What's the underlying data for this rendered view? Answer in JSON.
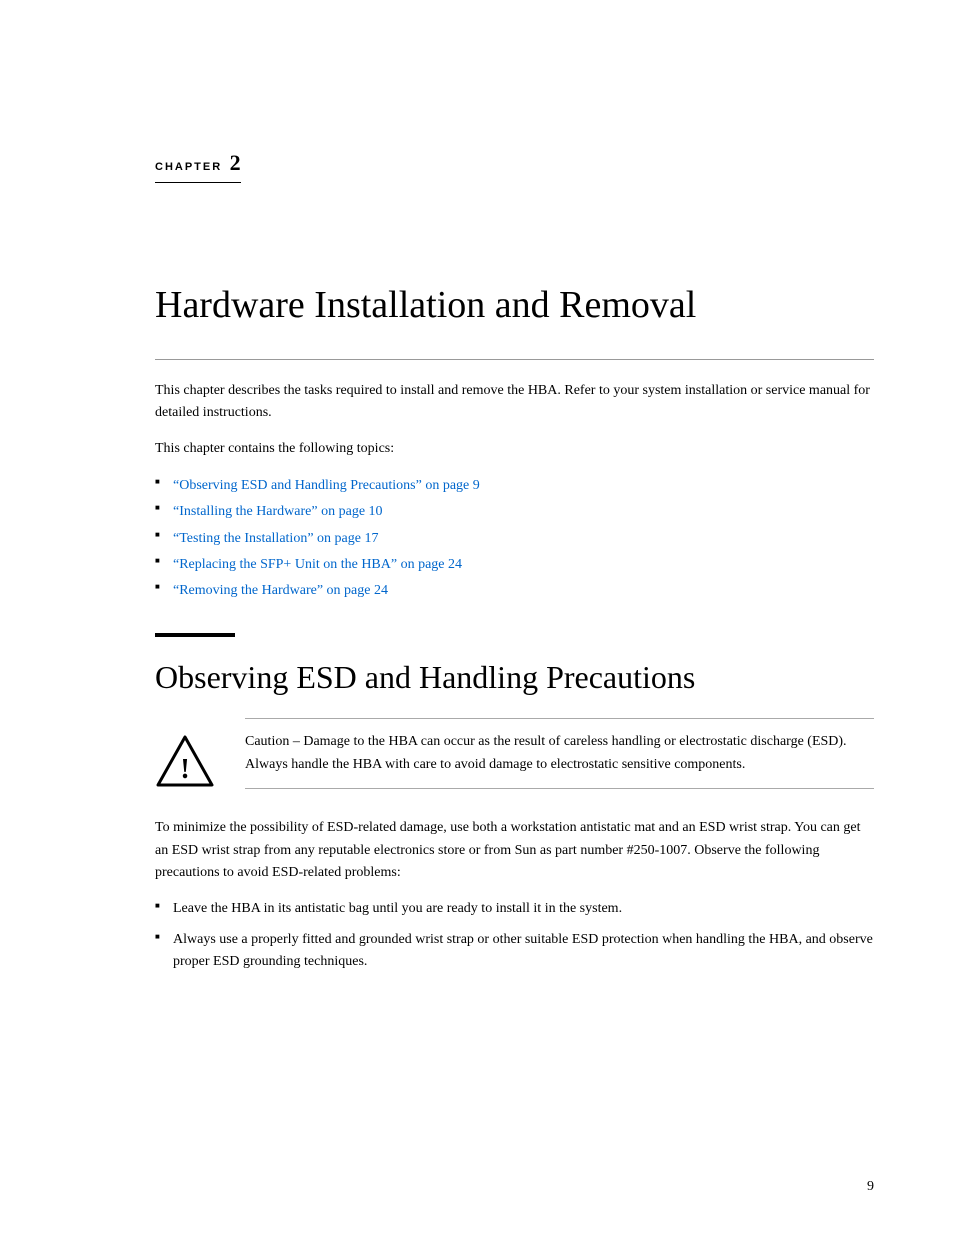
{
  "chapter": {
    "label": "Chapter",
    "number": "2",
    "title": "Hardware Installation and Removal"
  },
  "intro": {
    "paragraph1": "This chapter describes the tasks required to install and remove the HBA. Refer to your system installation or service manual for detailed instructions.",
    "paragraph2": "This chapter contains the following topics:"
  },
  "topics": [
    {
      "text": "“Observing ESD and Handling Precautions” on page 9",
      "href": "#esd"
    },
    {
      "text": "“Installing the Hardware” on page 10",
      "href": "#install"
    },
    {
      "text": "“Testing the Installation” on page 17",
      "href": "#test"
    },
    {
      "text": "“Replacing the SFP+ Unit on the HBA” on page 24",
      "href": "#replace"
    },
    {
      "text": "“Removing the Hardware” on page 24",
      "href": "#remove"
    }
  ],
  "section1": {
    "title": "Observing ESD and Handling Precautions"
  },
  "caution": {
    "label": "Caution –",
    "text": "Damage to the HBA can occur as the result of careless handling or electrostatic discharge (ESD). Always handle the HBA with care to avoid damage to electrostatic sensitive components."
  },
  "esd_body": {
    "paragraph1": "To minimize the possibility of ESD-related damage, use both a workstation antistatic mat and an ESD wrist strap. You can get an ESD wrist strap from any reputable electronics store or from Sun as part number #250-1007. Observe the following precautions to avoid ESD-related problems:",
    "bullets": [
      "Leave the HBA in its antistatic bag until you are ready to install it in the system.",
      "Always use a properly fitted and grounded wrist strap or other suitable ESD protection when handling the HBA, and observe proper ESD grounding techniques."
    ]
  },
  "page_number": "9"
}
